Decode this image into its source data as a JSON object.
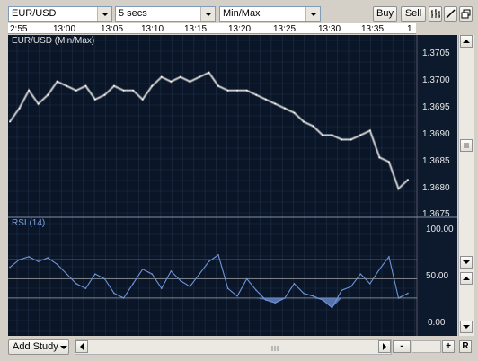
{
  "toolbar": {
    "symbol": "EUR/USD",
    "interval": "5 secs",
    "chart_style": "Min/Max",
    "buy_label": "Buy",
    "sell_label": "Sell"
  },
  "time_axis": {
    "ticks": [
      "2:55",
      "13:00",
      "13:05",
      "13:10",
      "13:15",
      "13:20",
      "13:25",
      "13:30",
      "13:35",
      "1"
    ]
  },
  "price_panel": {
    "title": "EUR/USD (Min/Max)",
    "ticks": [
      "1.3705",
      "1.3700",
      "1.3695",
      "1.3690",
      "1.3685",
      "1.3680",
      "1.3675"
    ]
  },
  "rsi_panel": {
    "title": "RSI (14)",
    "ticks": [
      "100.00",
      "50.00",
      "0.00"
    ]
  },
  "bottom": {
    "add_study_label": "Add Study",
    "minus_label": "-",
    "plus_label": "+",
    "r_label": "R"
  },
  "colors": {
    "chart_bg": "#0a1628",
    "grid": "#1e3048",
    "price_line": "#c8c8c8",
    "rsi_line": "#6f93d6",
    "rsi_fill": "#6f93d6",
    "ref_line": "#a0a0a0",
    "title_price": "#e0e0e0",
    "title_rsi": "#7ea0e0"
  },
  "chart_data": [
    {
      "type": "line",
      "title": "EUR/USD (Min/Max)",
      "x_range": [
        "12:55",
        "13:37"
      ],
      "ylim": [
        1.3674,
        1.3711
      ],
      "x": [
        "12:55",
        "12:56",
        "12:57",
        "12:58",
        "12:59",
        "13:00",
        "13:01",
        "13:02",
        "13:03",
        "13:04",
        "13:05",
        "13:06",
        "13:07",
        "13:08",
        "13:09",
        "13:10",
        "13:11",
        "13:12",
        "13:13",
        "13:14",
        "13:15",
        "13:16",
        "13:17",
        "13:18",
        "13:19",
        "13:20",
        "13:21",
        "13:22",
        "13:23",
        "13:24",
        "13:25",
        "13:26",
        "13:27",
        "13:28",
        "13:29",
        "13:30",
        "13:31",
        "13:32",
        "13:33",
        "13:34",
        "13:35",
        "13:36",
        "13:37"
      ],
      "series": [
        {
          "values": [
            1.3694,
            1.3697,
            1.3701,
            1.3698,
            1.37,
            1.3703,
            1.3702,
            1.3701,
            1.3702,
            1.3699,
            1.37,
            1.3702,
            1.3701,
            1.3701,
            1.3699,
            1.3702,
            1.3704,
            1.3703,
            1.3704,
            1.3703,
            1.3704,
            1.3705,
            1.3702,
            1.3701,
            1.3701,
            1.3701,
            1.37,
            1.3699,
            1.3698,
            1.3697,
            1.3696,
            1.3694,
            1.3693,
            1.3691,
            1.3691,
            1.369,
            1.369,
            1.3691,
            1.3692,
            1.3686,
            1.3685,
            1.3679,
            1.3681
          ]
        }
      ]
    },
    {
      "type": "area",
      "title": "RSI (14)",
      "ylim": [
        0,
        100
      ],
      "reference_lines": [
        70,
        50,
        30
      ],
      "x": [
        "12:55",
        "12:56",
        "12:57",
        "12:58",
        "12:59",
        "13:00",
        "13:01",
        "13:02",
        "13:03",
        "13:04",
        "13:05",
        "13:06",
        "13:07",
        "13:08",
        "13:09",
        "13:10",
        "13:11",
        "13:12",
        "13:13",
        "13:14",
        "13:15",
        "13:16",
        "13:17",
        "13:18",
        "13:19",
        "13:20",
        "13:21",
        "13:22",
        "13:23",
        "13:24",
        "13:25",
        "13:26",
        "13:27",
        "13:28",
        "13:29",
        "13:30",
        "13:31",
        "13:32",
        "13:33",
        "13:34",
        "13:35",
        "13:36",
        "13:37"
      ],
      "series": [
        {
          "values": [
            62,
            70,
            73,
            68,
            72,
            65,
            55,
            45,
            40,
            55,
            50,
            35,
            30,
            45,
            60,
            55,
            40,
            58,
            48,
            42,
            55,
            68,
            75,
            40,
            32,
            50,
            38,
            28,
            25,
            30,
            45,
            35,
            32,
            28,
            20,
            38,
            42,
            55,
            45,
            60,
            73,
            30,
            35
          ]
        }
      ]
    }
  ]
}
